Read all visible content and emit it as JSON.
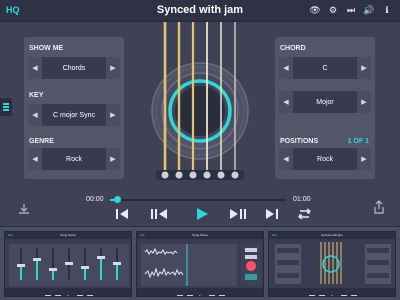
{
  "app": {
    "brand": "HQ",
    "title": "Synced with jam"
  },
  "top_icons": [
    {
      "name": "eye-icon",
      "glyph": "👁"
    },
    {
      "name": "gear-icon",
      "glyph": "⚙"
    },
    {
      "name": "skip-icon",
      "glyph": "⏭"
    },
    {
      "name": "sound-icon",
      "glyph": "🔊"
    },
    {
      "name": "info-icon",
      "glyph": "ℹ"
    }
  ],
  "left_panel": {
    "show_me": {
      "label": "SHOW ME",
      "value": "Chords"
    },
    "key": {
      "label": "KEY",
      "value": "C mojor Sync"
    },
    "genre": {
      "label": "GENRE",
      "value": "Rock"
    }
  },
  "right_panel": {
    "chord": {
      "label": "CHORD",
      "value": "C"
    },
    "quality": {
      "value": "Mojor"
    },
    "positions": {
      "label": "POSITIONS",
      "count": "1 OF 1",
      "value": "Rock"
    }
  },
  "playback": {
    "current_time": "00:00",
    "total_time": "01:00",
    "progress": 0.04
  },
  "colors": {
    "accent": "#2fd7d6",
    "record": "#ff4e6e",
    "background": "#3f4256",
    "panel": "#535669",
    "header": "#2f3244"
  },
  "thumbnails": [
    {
      "title": "Song Name"
    },
    {
      "title": "Song Name"
    },
    {
      "title": "Synced with jam"
    }
  ]
}
